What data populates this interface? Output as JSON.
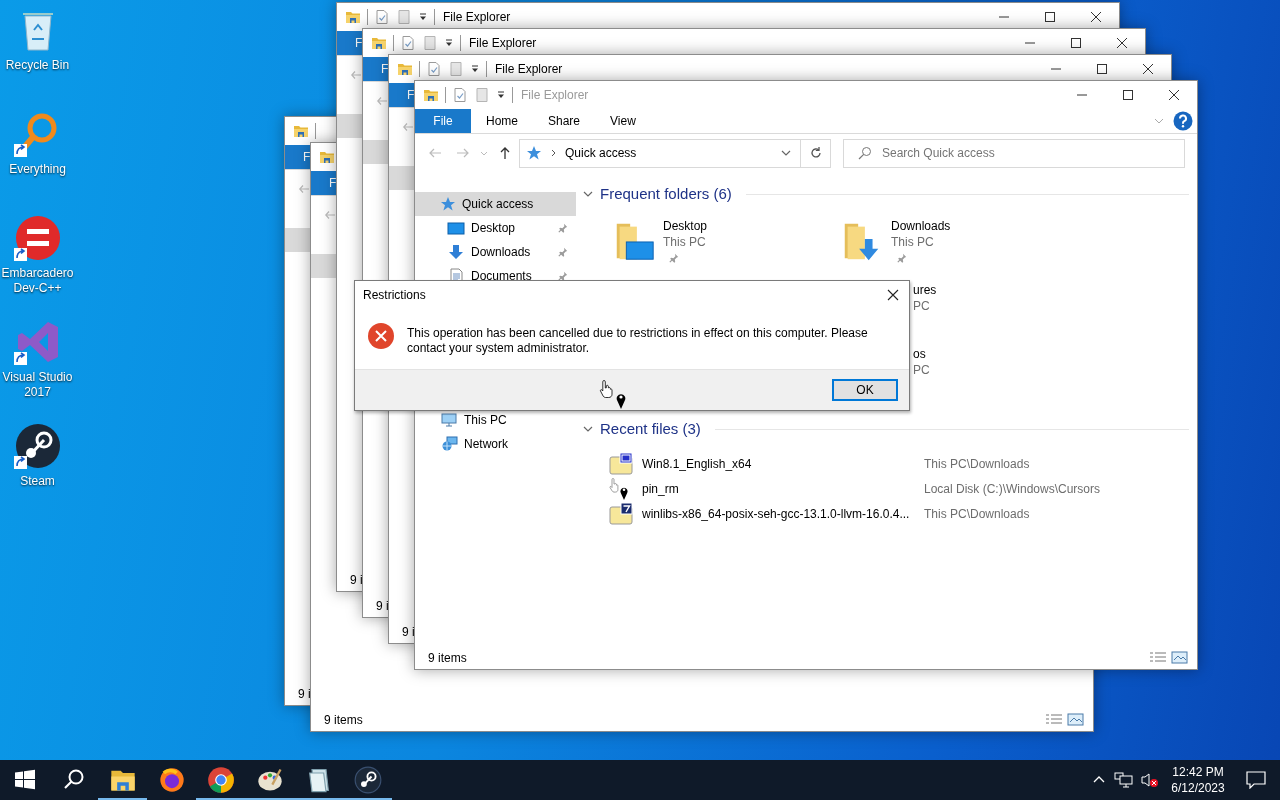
{
  "desktop_icons": [
    {
      "label": "Recycle Bin",
      "kind": "recycle"
    },
    {
      "label": "Everything",
      "kind": "everything"
    },
    {
      "label": "Embarcadero Dev-C++",
      "kind": "devcpp"
    },
    {
      "label": "Visual Studio 2017",
      "kind": "vs"
    },
    {
      "label": "Steam",
      "kind": "steam"
    }
  ],
  "background_windows": [
    {
      "tab": "F",
      "status": "9 i"
    },
    {
      "tab": "F",
      "status": "9 items",
      "view_icons": true
    },
    {
      "title": "File Explorer",
      "tab": "F",
      "status": "9 i"
    },
    {
      "title": "File Explorer",
      "tab": "F",
      "status": "9 i"
    },
    {
      "title": "File Explorer",
      "tab": "F",
      "status": "9 i"
    }
  ],
  "explorer": {
    "title": "File Explorer",
    "title_dimmed": true,
    "ribbon_tabs": [
      {
        "label": "File",
        "selected": true
      },
      {
        "label": "Home",
        "selected": false
      },
      {
        "label": "Share",
        "selected": false
      },
      {
        "label": "View",
        "selected": false
      }
    ],
    "address": "Quick access",
    "search": {
      "placeholder": "Search Quick access"
    },
    "sidebar": [
      {
        "label": "Quick access",
        "kind": "quick",
        "selected": true,
        "pinned": false,
        "children": [
          {
            "label": "Desktop",
            "kind": "desktop",
            "selected": false,
            "pinned": true
          },
          {
            "label": "Downloads",
            "kind": "downloads",
            "selected": false,
            "pinned": true
          },
          {
            "label": "Documents",
            "kind": "documents",
            "selected": false,
            "pinned": true
          }
        ]
      },
      {
        "label": "This PC",
        "kind": "pc",
        "selected": false,
        "pinned": false
      },
      {
        "label": "Network",
        "kind": "network",
        "selected": false,
        "pinned": false
      }
    ],
    "frequent": {
      "heading": "Frequent folders (6)",
      "expanded": true,
      "folders": [
        {
          "kind": "desktop",
          "name": "Desktop",
          "location": "This PC",
          "pinned": true
        },
        {
          "kind": "downloads",
          "name": "Downloads",
          "location": "This PC",
          "pinned": true
        },
        {
          "kind": "cut",
          "name": "ures",
          "location": "PC"
        },
        {
          "kind": "cut",
          "name": "os",
          "location": "PC"
        }
      ]
    },
    "recent": {
      "heading": "Recent files (3)",
      "expanded": true,
      "files": [
        {
          "kind": "iso",
          "name": "Win8.1_English_x64",
          "location": "This PC\\Downloads"
        },
        {
          "kind": "cursor",
          "name": "pin_rm",
          "location": "Local Disk (C:)\\Windows\\Cursors"
        },
        {
          "kind": "sevenzip",
          "name": "winlibs-x86_64-posix-seh-gcc-13.1.0-llvm-16.0.4...",
          "location": "This PC\\Downloads"
        }
      ]
    },
    "status": "9 items"
  },
  "dialog": {
    "title": "Restrictions",
    "message": "This operation has been cancelled due to restrictions in effect on this computer. Please contact your system administrator.",
    "button": "OK"
  },
  "taskbar": {
    "apps": [
      {
        "kind": "explorer",
        "running": true
      },
      {
        "kind": "firefox",
        "running": false
      },
      {
        "kind": "chrome",
        "running": true
      },
      {
        "kind": "paint",
        "running": true
      },
      {
        "kind": "notepad",
        "running": true
      },
      {
        "kind": "steam",
        "running": true
      }
    ],
    "time": "12:42 PM",
    "date": "6/12/2023"
  }
}
